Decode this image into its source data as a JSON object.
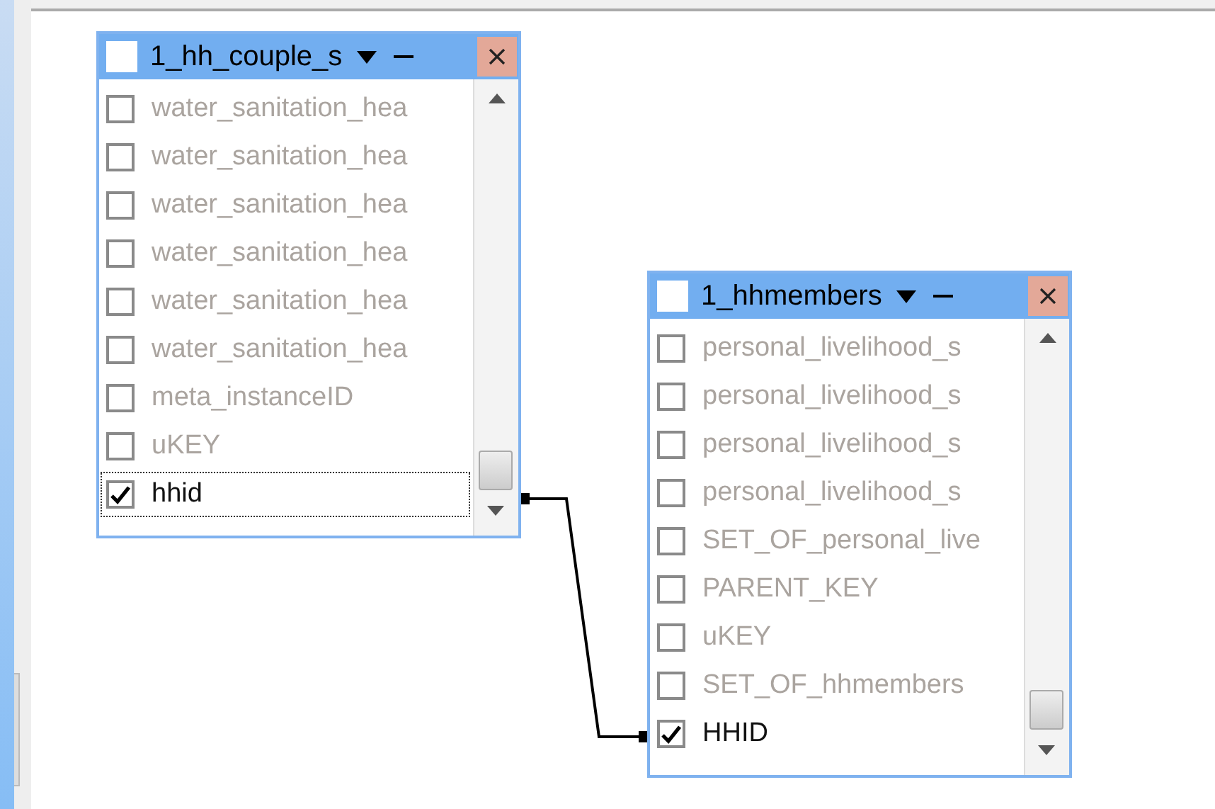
{
  "tables": [
    {
      "title": "1_hh_couple_s",
      "fields": [
        {
          "name": "water_sanitation_hea",
          "checked": false,
          "focused": false
        },
        {
          "name": "water_sanitation_hea",
          "checked": false,
          "focused": false
        },
        {
          "name": "water_sanitation_hea",
          "checked": false,
          "focused": false
        },
        {
          "name": "water_sanitation_hea",
          "checked": false,
          "focused": false
        },
        {
          "name": "water_sanitation_hea",
          "checked": false,
          "focused": false
        },
        {
          "name": "water_sanitation_hea",
          "checked": false,
          "focused": false
        },
        {
          "name": "meta_instanceID",
          "checked": false,
          "focused": false
        },
        {
          "name": "uKEY",
          "checked": false,
          "focused": false
        },
        {
          "name": "hhid",
          "checked": true,
          "focused": true
        }
      ]
    },
    {
      "title": "1_hhmembers",
      "fields": [
        {
          "name": "personal_livelihood_s",
          "checked": false,
          "focused": false
        },
        {
          "name": "personal_livelihood_s",
          "checked": false,
          "focused": false
        },
        {
          "name": "personal_livelihood_s",
          "checked": false,
          "focused": false
        },
        {
          "name": "personal_livelihood_s",
          "checked": false,
          "focused": false
        },
        {
          "name": "SET_OF_personal_live",
          "checked": false,
          "focused": false
        },
        {
          "name": "PARENT_KEY",
          "checked": false,
          "focused": false
        },
        {
          "name": "uKEY",
          "checked": false,
          "focused": false
        },
        {
          "name": "SET_OF_hhmembers",
          "checked": false,
          "focused": false
        },
        {
          "name": "HHID",
          "checked": true,
          "focused": false
        }
      ]
    }
  ]
}
